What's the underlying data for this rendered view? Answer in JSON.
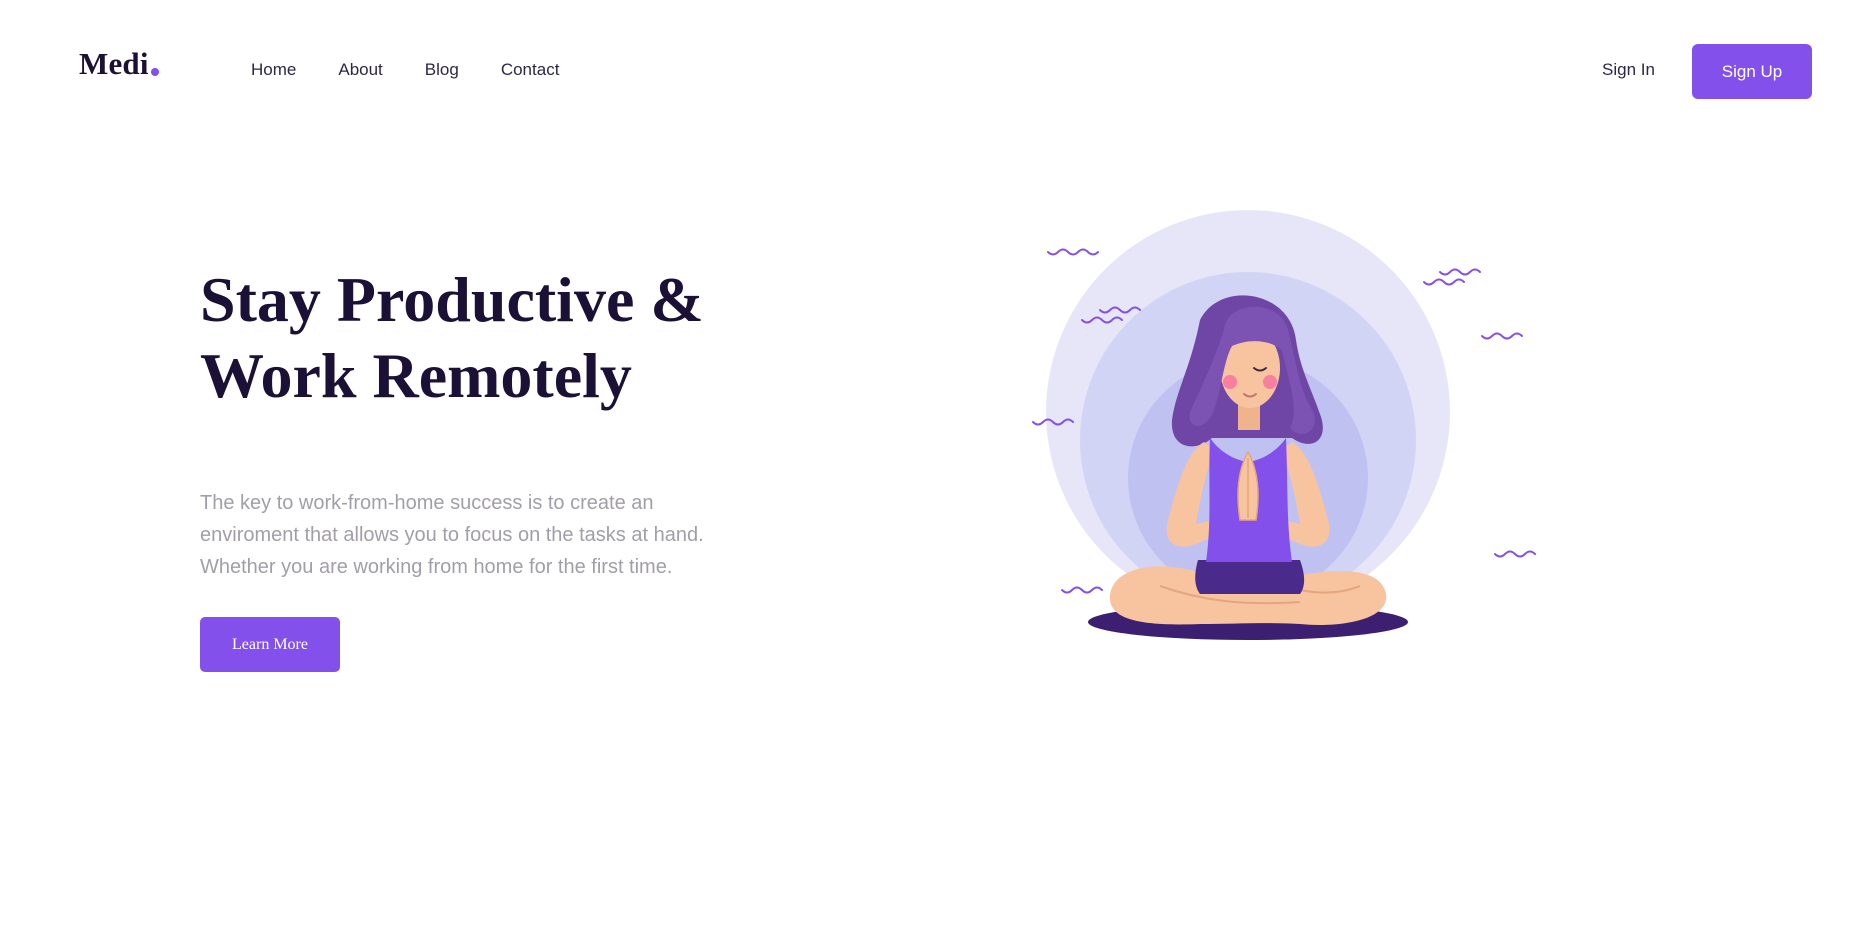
{
  "header": {
    "logo_text": "Medi",
    "nav": [
      {
        "label": "Home"
      },
      {
        "label": "About"
      },
      {
        "label": "Blog"
      },
      {
        "label": "Contact"
      }
    ],
    "sign_in_label": "Sign In",
    "sign_up_label": "Sign Up"
  },
  "hero": {
    "title_lines": [
      "Stay Productive &",
      "Work Remotely"
    ],
    "description_lines": [
      "The key to work-from-home success is to create an",
      "enviroment that allows you to focus on the tasks at hand.",
      "Whether you are working from home for the first time."
    ],
    "cta_label": "Learn More"
  },
  "illustration": {
    "icon": "meditating-woman-illustration",
    "colors": {
      "accent": "#8350ec",
      "circle_outer": "#e6e6f8",
      "circle_mid": "#d2d4f5",
      "circle_inner": "#bfc2f0",
      "hair": "#7c52b2",
      "skin": "#f8c4a0",
      "mat": "#3d1f72",
      "shorts": "#4a2a8a"
    }
  }
}
